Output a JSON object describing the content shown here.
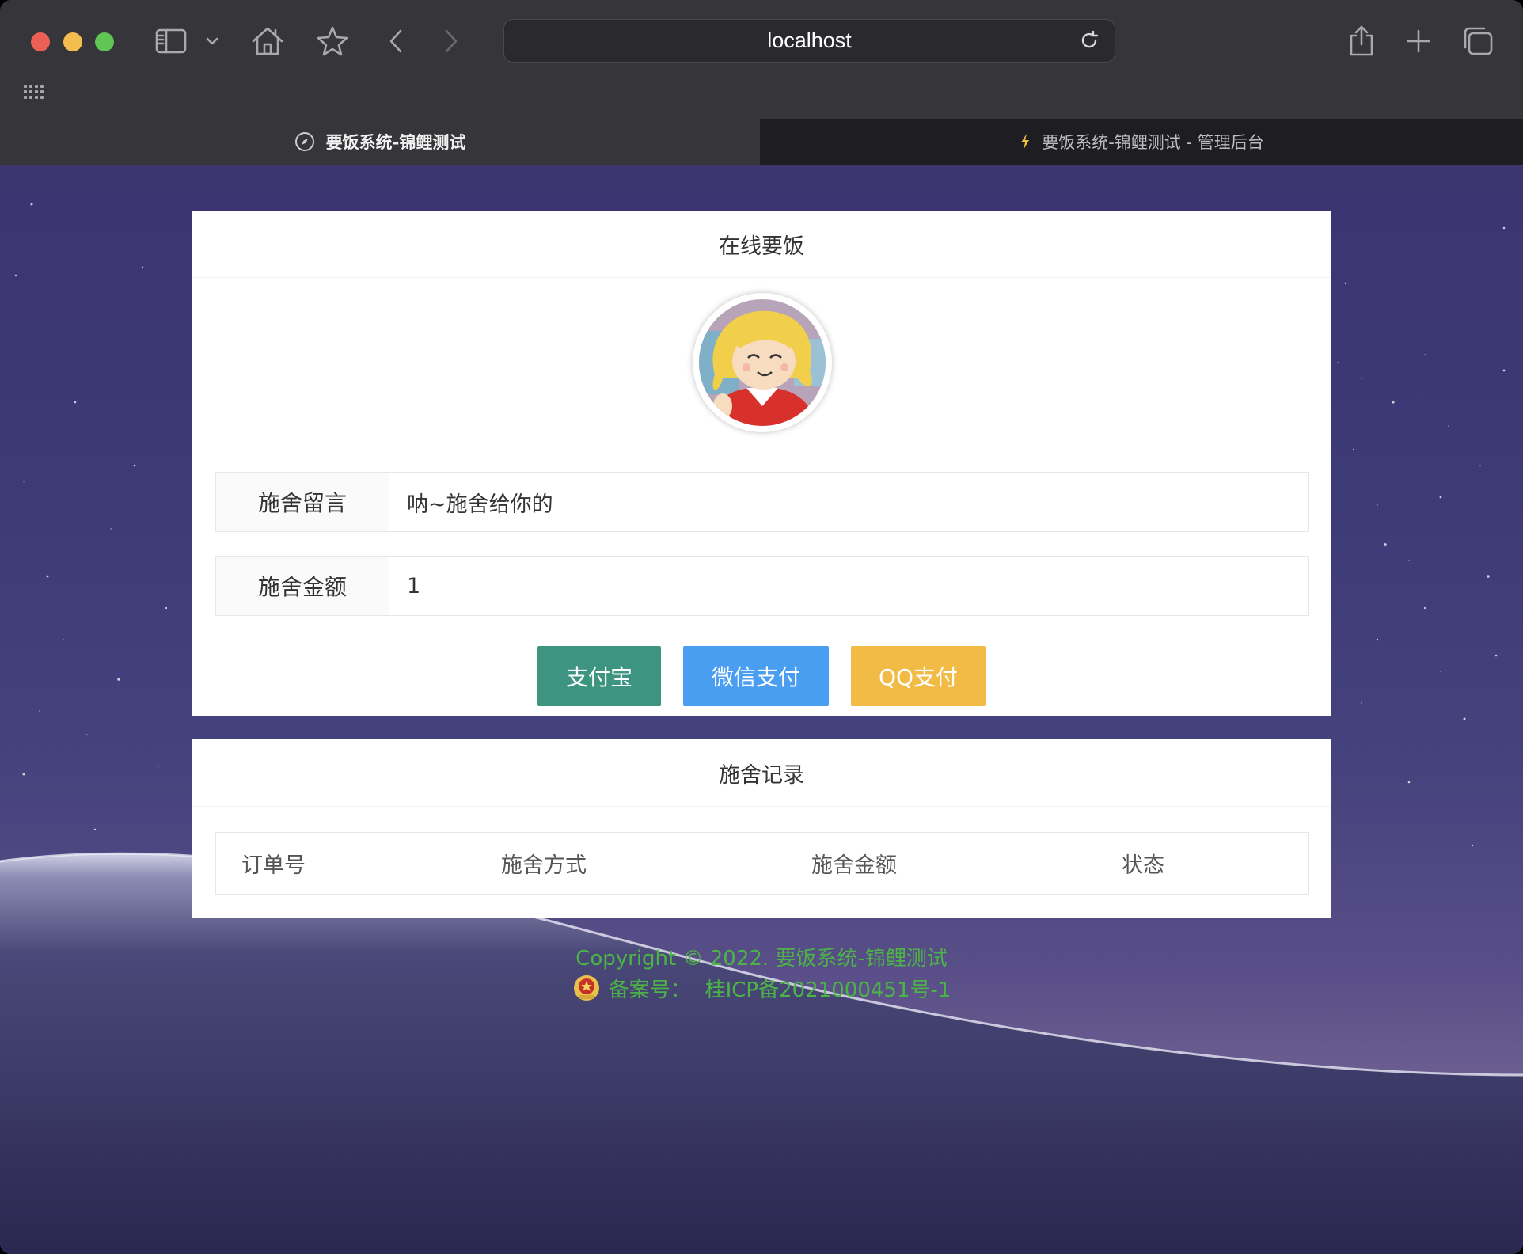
{
  "browser": {
    "address": "localhost",
    "tabs": [
      {
        "label": "要饭系统-锦鲤测试",
        "active": true
      },
      {
        "label": "要饭系统-锦鲤测试 - 管理后台",
        "active": false
      }
    ]
  },
  "donate_card": {
    "title": "在线要饭",
    "message_label": "施舍留言",
    "message_value": "呐~施舍给你的",
    "amount_label": "施舍金额",
    "amount_value": "1",
    "buttons": {
      "alipay": "支付宝",
      "wechat": "微信支付",
      "qq": "QQ支付"
    }
  },
  "records_card": {
    "title": "施舍记录",
    "columns": [
      "订单号",
      "施舍方式",
      "施舍金额",
      "状态"
    ]
  },
  "footer": {
    "copyright": "Copyright © 2022. 要饭系统-锦鲤测试",
    "icp_label": "备案号：",
    "icp_value": "桂ICP备2021000451号-1"
  },
  "colors": {
    "alipay": "#3d9480",
    "wechat": "#4a9ef2",
    "qq": "#f2bb45",
    "footer_text": "#4cb446"
  }
}
